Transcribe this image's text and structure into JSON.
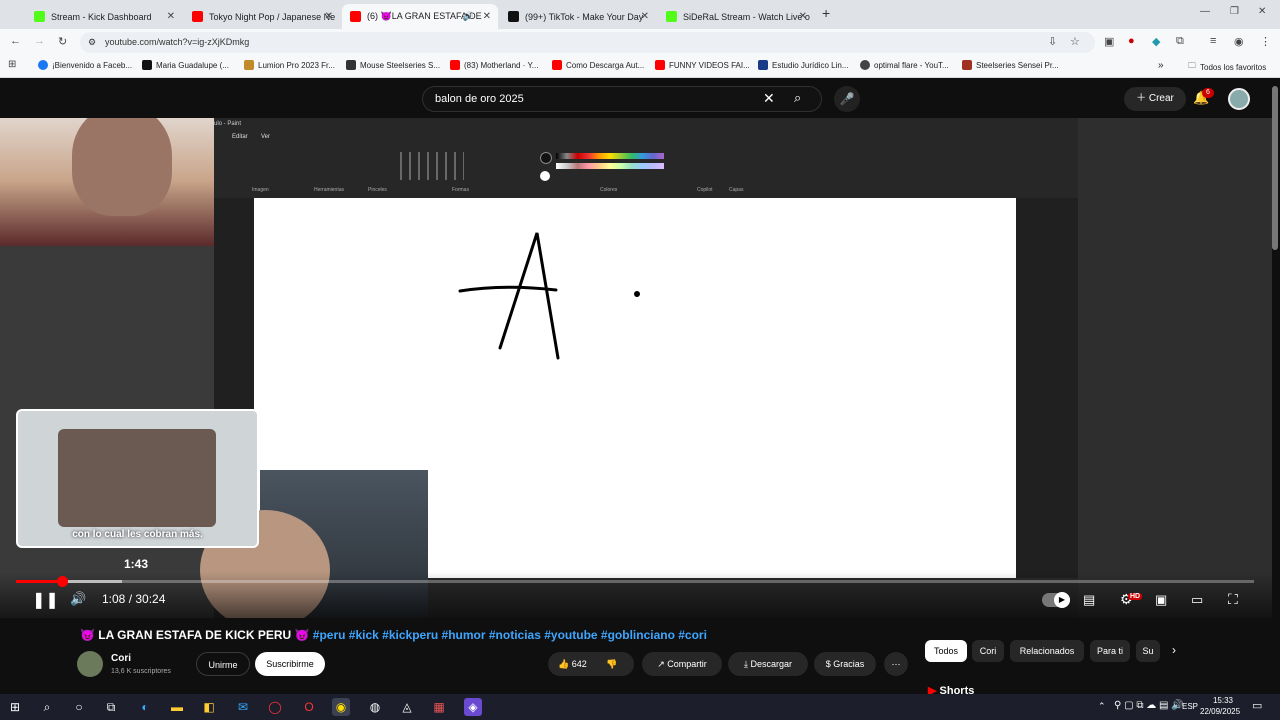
{
  "tabs": [
    {
      "label": "Stream - Kick Dashboard",
      "color": "#53fc18"
    },
    {
      "label": "Tokyo Night Pop / Japanese Ne",
      "color": "#ff0000"
    },
    {
      "label": "(6) 😈LA GRAN ESTAFA DE",
      "color": "#ff0000"
    },
    {
      "label": "(99+) TikTok - Make Your Day",
      "color": "#111111"
    },
    {
      "label": "SiDeRaL Stream - Watch Live o",
      "color": "#53fc18"
    }
  ],
  "address": {
    "url": "youtube.com/watch?v=ig-zXjKDmkg"
  },
  "bookmarks": [
    {
      "label": "¡Bienvenido a Faceb...",
      "color": "#1877f2"
    },
    {
      "label": "Maria Guadalupe (...",
      "color": "#111111"
    },
    {
      "label": "Lumion Pro 2023 Fr...",
      "color": "#c08a2a"
    },
    {
      "label": "Mouse Steelseries S...",
      "color": "#333333"
    },
    {
      "label": "(83) Motherland · Y...",
      "color": "#ff0000"
    },
    {
      "label": "Como Descarga Aut...",
      "color": "#ff0000"
    },
    {
      "label": "FUNNY VIDEOS FAI...",
      "color": "#ff0000"
    },
    {
      "label": "Estudio Jurídico Lin...",
      "color": "#1a3a8a"
    },
    {
      "label": "optimal flare - YouT...",
      "color": "#444444"
    },
    {
      "label": "Steelseries Sensei Pr...",
      "color": "#a03020"
    }
  ],
  "bookmarks_all": "Todos los favoritos",
  "youtube": {
    "search_query": "balon de oro 2025",
    "create_label": "Crear",
    "notif_count": "6"
  },
  "paint": {
    "window_title": "ulo - Paint",
    "menu": [
      "Editar",
      "Ver"
    ],
    "groups": [
      "Imagen",
      "Herramientas",
      "Pinceles",
      "Formas",
      "Colores",
      "Copilot",
      "Capas"
    ]
  },
  "player": {
    "hover_time": "1:43",
    "time": "1:08 / 30:24",
    "caption": "con lo cual les cobran más.",
    "progress_fraction": 0.037,
    "hd_badge": "HD"
  },
  "video": {
    "title_prefix": "😈 LA GRAN ESTAFA DE KICK PERU 😈",
    "hashtags": "#peru #kick #kickperu #humor #noticias #youtube #goblinciano #cori",
    "channel": "Cori",
    "subscribers": "13,6 K suscriptores",
    "join": "Unirme",
    "subscribe": "Suscribirme",
    "likes": "642",
    "share": "Compartir",
    "download": "Descargar",
    "thanks": "Gracias"
  },
  "chips": [
    "Todos",
    "Cori",
    "Relacionados",
    "Para ti",
    "Su"
  ],
  "shorts_label": "Shorts",
  "taskbar": {
    "lang": "ESP",
    "time": "15:33",
    "date": "22/09/2025"
  }
}
